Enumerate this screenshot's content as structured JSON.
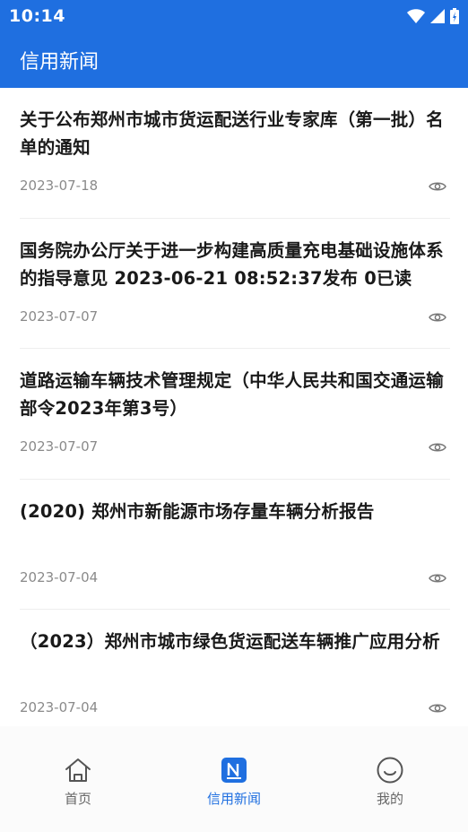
{
  "status_bar": {
    "time": "10:14"
  },
  "app_bar": {
    "title": "信用新闻"
  },
  "news": [
    {
      "title": "关于公布郑州市城市货运配送行业专家库（第一批）名单的通知",
      "date": "2023-07-18"
    },
    {
      "title": "国务院办公厅关于进一步构建高质量充电基础设施体系的指导意见 2023-06-21 08:52:37发布 0已读",
      "date": "2023-07-07"
    },
    {
      "title": "道路运输车辆技术管理规定（中华人民共和国交通运输部令2023年第3号）",
      "date": "2023-07-07"
    },
    {
      "title": "(2020) 郑州市新能源市场存量车辆分析报告",
      "date": "2023-07-04"
    },
    {
      "title": "（2023）郑州市城市绿色货运配送车辆推广应用分析",
      "date": "2023-07-04"
    }
  ],
  "bottom_nav": {
    "items": [
      {
        "label": "首页",
        "icon": "home-icon"
      },
      {
        "label": "信用新闻",
        "icon": "news-icon",
        "active": true
      },
      {
        "label": "我的",
        "icon": "smiley-icon"
      }
    ]
  },
  "colors": {
    "primary": "#1f6fe0",
    "date": "#8a8a8a",
    "title": "#1a1a1a"
  }
}
